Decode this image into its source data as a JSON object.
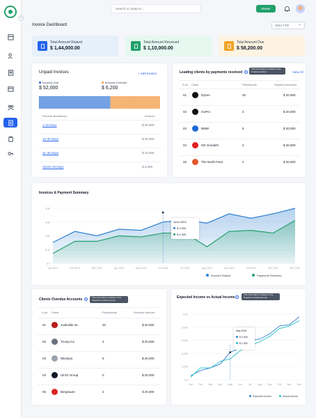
{
  "search": {
    "placeholder": "Search or Jump to..."
  },
  "header": {
    "starter": "Starter",
    "title": "Invoice Dashboard",
    "period": "2024 YTD"
  },
  "stats": [
    {
      "label": "Total Amount Raised",
      "value": "$ 1,44,000.00",
      "color": "#e6f0fb",
      "icon_color": "#2563eb"
    },
    {
      "label": "Total Amount Received",
      "value": "$ 1,10,000.00",
      "color": "#e6f8ef",
      "icon_color": "#22a06b"
    },
    {
      "label": "Total Amount Due",
      "value": "$ 58,200.00",
      "color": "#fdf3e2",
      "icon_color": "#f0a526"
    }
  ],
  "unpaid": {
    "title": "Unpaid Invoices",
    "add": "+ Add Invoice",
    "due_label": "Invoices Due",
    "due_value": "$ 52,000",
    "overdue_label": "Invoices Overdue",
    "overdue_value": "$ 6,200",
    "breakdown_header": "Overdue Breakdown",
    "amount_header": "Amount",
    "rows": [
      {
        "label": "1-15 Days",
        "amount": "$ 20,000"
      },
      {
        "label": "16-30 Days",
        "amount": "$ 20,000"
      },
      {
        "label": "31-45 Days",
        "amount": "$ 10,000"
      },
      {
        "label": "Above 45 Days",
        "amount": "$ 2,000"
      }
    ]
  },
  "leading": {
    "title": "Leading clients by payments received",
    "tooltip": "This information is based on the invoices amount",
    "view_all": "View All",
    "headers": [
      "S.no",
      "Client",
      "Placements",
      "Payment received"
    ],
    "rows": [
      {
        "sno": "01",
        "client": "Dyson",
        "placements": "20",
        "amount": "$ 20,000"
      },
      {
        "sno": "02",
        "client": "GoPro",
        "placements": "4",
        "amount": "$ 20,000"
      },
      {
        "sno": "03",
        "client": "BMW",
        "placements": "5",
        "amount": "$ 20,000"
      },
      {
        "sno": "04",
        "client": "MC Donald's",
        "placements": "0",
        "amount": "$ 20,000"
      },
      {
        "sno": "05",
        "client": "The North Face",
        "placements": "2",
        "amount": "$ 20,000"
      }
    ]
  },
  "summary": {
    "title": "Invoices & Payment Summary",
    "legend": [
      "Invoices Raised",
      "Payments Received"
    ],
    "tooltip_title": "June 2024",
    "tooltip_raised": "$ 2,000",
    "tooltip_received": "$ 1,000",
    "colors": {
      "raised": "#2f80d1",
      "received": "#22a06b"
    }
  },
  "chart_data": [
    {
      "type": "area",
      "title": "Invoices & Payment Summary",
      "categories": [
        "Jan 2024",
        "Feb 2024",
        "Mar 2024",
        "Apr 2024",
        "May 2024",
        "Jun 2024",
        "Jul 2024",
        "Aug 2024",
        "Sep 2024",
        "Oct 2024",
        "Nov 2024",
        "Dec 2024"
      ],
      "yticks": [
        "$ 0",
        "$ 40",
        "$ 60",
        "$ 80",
        "$ 90"
      ],
      "ylim": [
        0,
        100
      ],
      "series": [
        {
          "name": "Invoices Raised",
          "values": [
            38,
            58,
            50,
            62,
            60,
            75,
            79,
            73,
            90,
            82,
            90,
            100
          ]
        },
        {
          "name": "Payments Received",
          "values": [
            18,
            40,
            40,
            50,
            48,
            55,
            55,
            30,
            58,
            60,
            55,
            78
          ]
        }
      ]
    },
    {
      "type": "line",
      "title": "Expected Income vs Actual Income",
      "categories": [
        "Jan",
        "Feb",
        "Mar",
        "Apr",
        "May",
        "Jun",
        "Jul",
        "Aug",
        "Sep",
        "Oct",
        "Nov",
        "Dec"
      ],
      "yticks": [
        "$ 0",
        "$ 200",
        "$ 400",
        "$ 600",
        "$ 800",
        "$ 1k"
      ],
      "ylim": [
        0,
        1000
      ],
      "series": [
        {
          "name": "Expected Income",
          "values": [
            60,
            140,
            180,
            240,
            420,
            480,
            600,
            620,
            700,
            820,
            840,
            960
          ]
        },
        {
          "name": "Actual Income",
          "values": [
            40,
            180,
            180,
            280,
            320,
            440,
            520,
            580,
            660,
            780,
            820,
            900
          ]
        }
      ]
    }
  ],
  "overdue_clients": {
    "title": "Clients Overdue Accounts",
    "tooltip": "This information is based on the Overdue invoices amount",
    "headers": [
      "S.no",
      "Client",
      "Placements",
      "Overdue Amount"
    ],
    "rows": [
      {
        "sno": "01",
        "client": "Joskolski Inc",
        "placements": "20",
        "amount": "$ 20,000"
      },
      {
        "sno": "02",
        "client": "Trump Inc",
        "placements": "4",
        "amount": "$ 20,000"
      },
      {
        "sno": "03",
        "client": "Nikolaus",
        "placements": "5",
        "amount": "$ 20,000"
      },
      {
        "sno": "04",
        "client": "Ulrich Group",
        "placements": "0",
        "amount": "$ 20,000"
      },
      {
        "sno": "05",
        "client": "Bergnaum",
        "placements": "2",
        "amount": "$ 20,000"
      }
    ]
  },
  "income": {
    "title": "Expected Income vs Actual Income",
    "tooltip": "This information is based on the Overdue invoices amount",
    "legend": [
      "Expected Income",
      "Actual Income"
    ],
    "tooltip_title": "May 2024",
    "tooltip_expected": "$ 2,000",
    "tooltip_actual": "$ 1,000",
    "colors": {
      "expected": "#2f80d1",
      "actual": "#22c3c3"
    }
  }
}
